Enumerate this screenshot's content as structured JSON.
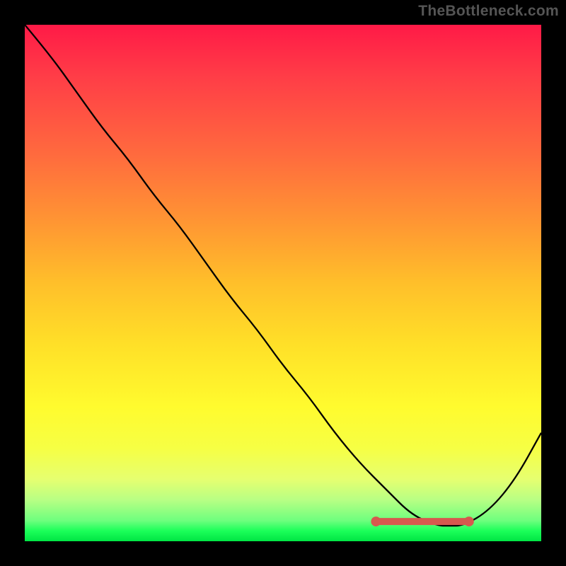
{
  "watermark": "TheBottleneck.com",
  "chart_data": {
    "type": "line",
    "title": "",
    "xlabel": "",
    "ylabel": "",
    "xlim": [
      0,
      100
    ],
    "ylim": [
      0,
      100
    ],
    "grid": false,
    "legend": false,
    "series": [
      {
        "name": "bottleneck-curve",
        "x": [
          0,
          5,
          10,
          15,
          20,
          25,
          30,
          35,
          40,
          45,
          50,
          55,
          60,
          65,
          70,
          75,
          80,
          82,
          85,
          90,
          95,
          100
        ],
        "values": [
          100,
          94,
          87,
          80,
          74,
          67,
          61,
          54,
          47,
          41,
          34,
          28,
          21,
          15,
          10,
          5,
          3,
          3,
          3,
          6,
          12,
          21
        ]
      }
    ],
    "optimal_range": {
      "x_start": 68,
      "x_end": 86,
      "y": 3
    },
    "background_gradient": {
      "top": "#ff1a47",
      "mid": "#fffb2e",
      "bottom": "#00e544"
    },
    "curve_color": "#000000",
    "marker_color": "#d7584e"
  }
}
